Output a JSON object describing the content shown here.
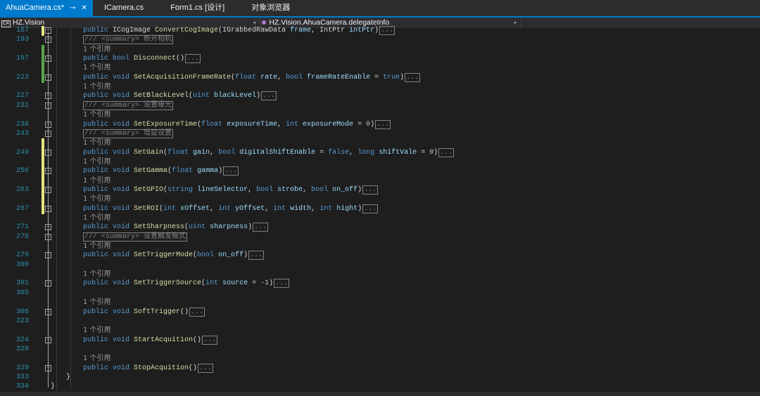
{
  "tabs": [
    {
      "label": "AhuaCamera.cs*",
      "active": true
    },
    {
      "label": "ICamera.cs"
    },
    {
      "label": "Form1.cs [设计]"
    },
    {
      "label": "对象浏览器"
    }
  ],
  "nav": {
    "project": "HZ.Vision",
    "member": "HZ.Vision.AhuaCamera.delegateInfo",
    "cs_icon": "C#"
  },
  "colors": {
    "accent": "#007acc",
    "changed_saved": "#57a64a",
    "changed_unsaved": "#e5e57e"
  },
  "rows": [
    {
      "ln": "157",
      "fold": true,
      "bar": "y",
      "code": [
        [
          "k",
          "public "
        ],
        [
          "t",
          "ICogImage "
        ],
        [
          "m",
          "ConvertCogImage"
        ],
        [
          "t",
          "("
        ],
        [
          "t",
          "IGrabbedRawData "
        ],
        [
          "p",
          "frame"
        ],
        [
          "t",
          ", "
        ],
        [
          "t",
          "IntPtr "
        ],
        [
          "p",
          "intPtr"
        ],
        [
          "t",
          ")"
        ],
        [
          "e",
          "..."
        ]
      ]
    },
    {
      "ln": "193",
      "fold": true,
      "code": [
        [
          "c",
          "/// <summary> 断开相机"
        ]
      ]
    },
    {
      "ref": "1 个引用",
      "bar": "g"
    },
    {
      "ln": "197",
      "fold": true,
      "bar": "g",
      "code": [
        [
          "k",
          "public bool "
        ],
        [
          "m",
          "Disconnect"
        ],
        [
          "t",
          "()"
        ],
        [
          "e",
          "..."
        ]
      ]
    },
    {
      "ref": "1 个引用",
      "bar": "g"
    },
    {
      "ln": "223",
      "fold": true,
      "bar": "g",
      "code": [
        [
          "k",
          "public void "
        ],
        [
          "m",
          "SetAcquisitionFrameRate"
        ],
        [
          "t",
          "("
        ],
        [
          "k",
          "float "
        ],
        [
          "p",
          "rate"
        ],
        [
          "t",
          ", "
        ],
        [
          "k",
          "bool "
        ],
        [
          "p",
          "frameRateEnable"
        ],
        [
          "t",
          " = "
        ],
        [
          "k",
          "true"
        ],
        [
          "t",
          ")"
        ],
        [
          "e",
          "..."
        ]
      ]
    },
    {
      "ref": "1 个引用"
    },
    {
      "ln": "227",
      "fold": true,
      "code": [
        [
          "k",
          "public void "
        ],
        [
          "m",
          "SetBlackLevel"
        ],
        [
          "t",
          "("
        ],
        [
          "k",
          "uint "
        ],
        [
          "p",
          "blackLevel"
        ],
        [
          "t",
          ")"
        ],
        [
          "e",
          "..."
        ]
      ]
    },
    {
      "ln": "231",
      "fold": true,
      "code": [
        [
          "c",
          "/// <summary> 设置曝光"
        ]
      ]
    },
    {
      "ref": "1 个引用"
    },
    {
      "ln": "236",
      "fold": true,
      "code": [
        [
          "k",
          "public void "
        ],
        [
          "m",
          "SetExposureTime"
        ],
        [
          "t",
          "("
        ],
        [
          "k",
          "float "
        ],
        [
          "p",
          "exposureTime"
        ],
        [
          "t",
          ", "
        ],
        [
          "k",
          "int "
        ],
        [
          "p",
          "exposureMode"
        ],
        [
          "t",
          " = "
        ],
        [
          "n",
          "0"
        ],
        [
          "t",
          ")"
        ],
        [
          "e",
          "..."
        ]
      ]
    },
    {
      "ln": "243",
      "fold": true,
      "code": [
        [
          "c",
          "/// <summary> 增益设置"
        ]
      ]
    },
    {
      "ref": "1 个引用",
      "bar": "y"
    },
    {
      "ln": "249",
      "fold": true,
      "bar": "y",
      "code": [
        [
          "k",
          "public void "
        ],
        [
          "m",
          "SetGain"
        ],
        [
          "t",
          "("
        ],
        [
          "k",
          "float "
        ],
        [
          "p",
          "gain"
        ],
        [
          "t",
          ", "
        ],
        [
          "k",
          "bool "
        ],
        [
          "p",
          "digitalShiftEnable"
        ],
        [
          "t",
          " = "
        ],
        [
          "k",
          "false"
        ],
        [
          "t",
          ", "
        ],
        [
          "k",
          "long "
        ],
        [
          "p",
          "shiftVale"
        ],
        [
          "t",
          " = "
        ],
        [
          "n",
          "0"
        ],
        [
          "t",
          ")"
        ],
        [
          "e",
          "..."
        ]
      ]
    },
    {
      "ref": "1 个引用",
      "bar": "y"
    },
    {
      "ln": "256",
      "fold": true,
      "bar": "y",
      "code": [
        [
          "k",
          "public void "
        ],
        [
          "m",
          "SetGamma"
        ],
        [
          "t",
          "("
        ],
        [
          "k",
          "float "
        ],
        [
          "p",
          "gamma"
        ],
        [
          "t",
          ")"
        ],
        [
          "e",
          "..."
        ]
      ]
    },
    {
      "ref": "1 个引用",
      "bar": "y"
    },
    {
      "ln": "263",
      "fold": true,
      "bar": "y",
      "code": [
        [
          "k",
          "public void "
        ],
        [
          "m",
          "SetGPIO"
        ],
        [
          "t",
          "("
        ],
        [
          "k",
          "string "
        ],
        [
          "p",
          "lineSelector"
        ],
        [
          "t",
          ", "
        ],
        [
          "k",
          "bool "
        ],
        [
          "p",
          "strobe"
        ],
        [
          "t",
          ", "
        ],
        [
          "k",
          "bool "
        ],
        [
          "p",
          "on_off"
        ],
        [
          "t",
          ")"
        ],
        [
          "e",
          "..."
        ]
      ]
    },
    {
      "ref": "1 个引用",
      "bar": "y"
    },
    {
      "ln": "267",
      "fold": true,
      "bar": "y",
      "code": [
        [
          "k",
          "public void "
        ],
        [
          "m",
          "SetROI"
        ],
        [
          "t",
          "("
        ],
        [
          "k",
          "int "
        ],
        [
          "p",
          "xOffset"
        ],
        [
          "t",
          ", "
        ],
        [
          "k",
          "int "
        ],
        [
          "p",
          "yOffset"
        ],
        [
          "t",
          ", "
        ],
        [
          "k",
          "int "
        ],
        [
          "p",
          "width"
        ],
        [
          "t",
          ", "
        ],
        [
          "k",
          "int "
        ],
        [
          "p",
          "hight"
        ],
        [
          "t",
          ")"
        ],
        [
          "e",
          "..."
        ]
      ]
    },
    {
      "ref": "1 个引用"
    },
    {
      "ln": "271",
      "fold": true,
      "code": [
        [
          "k",
          "public void "
        ],
        [
          "m",
          "SetSharpness"
        ],
        [
          "t",
          "("
        ],
        [
          "k",
          "uint "
        ],
        [
          "p",
          "sharpness"
        ],
        [
          "t",
          ")"
        ],
        [
          "e",
          "..."
        ]
      ]
    },
    {
      "ln": "275",
      "fold": true,
      "code": [
        [
          "c",
          "/// <summary> 设置触发模式"
        ]
      ]
    },
    {
      "ref": "1 个引用"
    },
    {
      "ln": "279",
      "fold": true,
      "code": [
        [
          "k",
          "public void "
        ],
        [
          "m",
          "SetTriggerMode"
        ],
        [
          "t",
          "("
        ],
        [
          "k",
          "bool "
        ],
        [
          "p",
          "on_off"
        ],
        [
          "t",
          ")"
        ],
        [
          "e",
          "..."
        ]
      ]
    },
    {
      "ln": "300"
    },
    {
      "ref": "1 个引用"
    },
    {
      "ln": "301",
      "fold": true,
      "code": [
        [
          "k",
          "public void "
        ],
        [
          "m",
          "SetTriggerSource"
        ],
        [
          "t",
          "("
        ],
        [
          "k",
          "int "
        ],
        [
          "p",
          "source"
        ],
        [
          "t",
          " = "
        ],
        [
          "n",
          "-1"
        ],
        [
          "t",
          ")"
        ],
        [
          "e",
          "..."
        ]
      ]
    },
    {
      "ln": "305"
    },
    {
      "ref": "1 个引用"
    },
    {
      "ln": "306",
      "fold": true,
      "code": [
        [
          "k",
          "public void "
        ],
        [
          "m",
          "SoftTrigger"
        ],
        [
          "t",
          "()"
        ],
        [
          "e",
          "..."
        ]
      ]
    },
    {
      "ln": "323"
    },
    {
      "ref": "1 个引用"
    },
    {
      "ln": "324",
      "fold": true,
      "code": [
        [
          "k",
          "public void "
        ],
        [
          "m",
          "StartAcquition"
        ],
        [
          "t",
          "()"
        ],
        [
          "e",
          "..."
        ]
      ]
    },
    {
      "ln": "328"
    },
    {
      "ref": "1 个引用"
    },
    {
      "ln": "329",
      "fold": true,
      "code": [
        [
          "k",
          "public void "
        ],
        [
          "m",
          "StopAcquition"
        ],
        [
          "t",
          "()"
        ],
        [
          "e",
          "..."
        ]
      ]
    },
    {
      "ln": "333",
      "indent": 1,
      "code": [
        [
          "t",
          "}"
        ]
      ]
    },
    {
      "ln": "334",
      "indent": 0,
      "code": [
        [
          "t",
          "}"
        ]
      ]
    }
  ]
}
